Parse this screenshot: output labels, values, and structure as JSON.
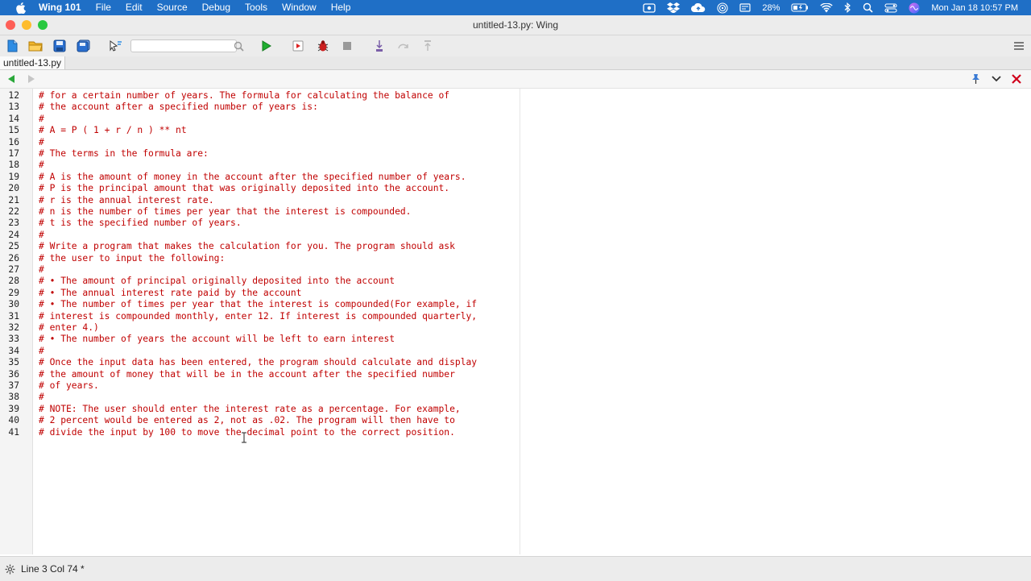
{
  "menubar": {
    "app_name": "Wing 101",
    "items": [
      "File",
      "Edit",
      "Source",
      "Debug",
      "Tools",
      "Window",
      "Help"
    ],
    "battery": "28%",
    "clock": "Mon Jan 18  10:57 PM"
  },
  "window": {
    "title": "untitled-13.py: Wing"
  },
  "toolbar": {
    "search_placeholder": ""
  },
  "tab": {
    "label": "untitled-13.py"
  },
  "editor": {
    "lines": [
      {
        "num": "12",
        "text": "# for a certain number of years. The formula for calculating the balance of"
      },
      {
        "num": "13",
        "text": "# the account after a specified number of years is:"
      },
      {
        "num": "14",
        "text": "#"
      },
      {
        "num": "15",
        "text": "# A = P ( 1 + r / n ) ** nt"
      },
      {
        "num": "16",
        "text": "#"
      },
      {
        "num": "17",
        "text": "# The terms in the formula are:"
      },
      {
        "num": "18",
        "text": "#"
      },
      {
        "num": "19",
        "text": "# A is the amount of money in the account after the specified number of years."
      },
      {
        "num": "20",
        "text": "# P is the principal amount that was originally deposited into the account."
      },
      {
        "num": "21",
        "text": "# r is the annual interest rate."
      },
      {
        "num": "22",
        "text": "# n is the number of times per year that the interest is compounded."
      },
      {
        "num": "23",
        "text": "# t is the specified number of years."
      },
      {
        "num": "24",
        "text": "#"
      },
      {
        "num": "25",
        "text": "# Write a program that makes the calculation for you. The program should ask"
      },
      {
        "num": "26",
        "text": "# the user to input the following:"
      },
      {
        "num": "27",
        "text": "#"
      },
      {
        "num": "28",
        "text": "# • The amount of principal originally deposited into the account"
      },
      {
        "num": "29",
        "text": "# • The annual interest rate paid by the account"
      },
      {
        "num": "30",
        "text": "# • The number of times per year that the interest is compounded(For example, if"
      },
      {
        "num": "31",
        "text": "# interest is compounded monthly, enter 12. If interest is compounded quarterly,"
      },
      {
        "num": "32",
        "text": "# enter 4.)"
      },
      {
        "num": "33",
        "text": "# • The number of years the account will be left to earn interest"
      },
      {
        "num": "34",
        "text": "#"
      },
      {
        "num": "35",
        "text": "# Once the input data has been entered, the program should calculate and display"
      },
      {
        "num": "36",
        "text": "# the amount of money that will be in the account after the specified number"
      },
      {
        "num": "37",
        "text": "# of years."
      },
      {
        "num": "38",
        "text": "#"
      },
      {
        "num": "39",
        "text": "# NOTE: The user should enter the interest rate as a percentage. For example,"
      },
      {
        "num": "40",
        "text": "# 2 percent would be entered as 2, not as .02. The program will then have to"
      },
      {
        "num": "41",
        "text": "# divide the input by 100 to move the decimal point to the correct position."
      }
    ]
  },
  "statusbar": {
    "text": "Line 3 Col 74 *"
  },
  "colors": {
    "menubar": "#1f6fc6",
    "comment": "#c00000",
    "close_light": "#fe5f57",
    "minimize_light": "#febc2e",
    "zoom_light": "#28c840"
  }
}
